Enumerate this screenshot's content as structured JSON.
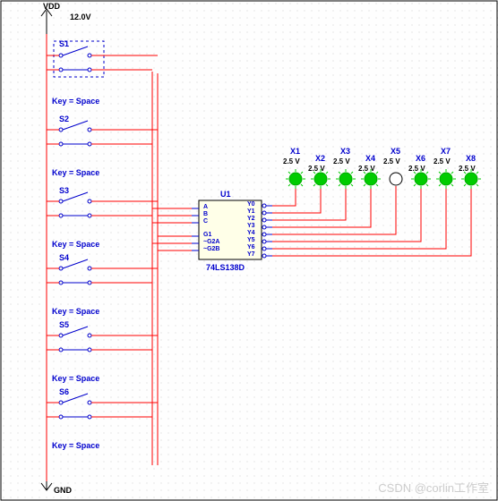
{
  "power": {
    "vdd_label": "VDD",
    "vdd_voltage": "12.0V",
    "gnd_label": "GND"
  },
  "switches": [
    {
      "name": "S1",
      "key": "Key = Space"
    },
    {
      "name": "S2",
      "key": "Key = Space"
    },
    {
      "name": "S3",
      "key": "Key = Space"
    },
    {
      "name": "S4",
      "key": "Key = Space"
    },
    {
      "name": "S5",
      "key": "Key = Space"
    },
    {
      "name": "S6",
      "key": "Key = Space"
    }
  ],
  "chip": {
    "ref": "U1",
    "part": "74LS138D",
    "pins_left": [
      "A",
      "B",
      "C",
      "",
      "G1",
      "~G2A",
      "~G2B"
    ],
    "pins_right": [
      "Y0",
      "Y1",
      "Y2",
      "Y3",
      "Y4",
      "Y5",
      "Y6",
      "Y7"
    ]
  },
  "probes": [
    {
      "name": "X1",
      "v": "2.5 V",
      "on": true
    },
    {
      "name": "X2",
      "v": "2.5 V",
      "on": true
    },
    {
      "name": "X3",
      "v": "2.5 V",
      "on": true
    },
    {
      "name": "X4",
      "v": "2.5 V",
      "on": true
    },
    {
      "name": "X5",
      "v": "2.5 V",
      "on": false
    },
    {
      "name": "X6",
      "v": "2.5 V",
      "on": true
    },
    {
      "name": "X7",
      "v": "2.5 V",
      "on": true
    },
    {
      "name": "X8",
      "v": "2.5 V",
      "on": true
    }
  ],
  "watermark": "CSDN @corlin工作室"
}
